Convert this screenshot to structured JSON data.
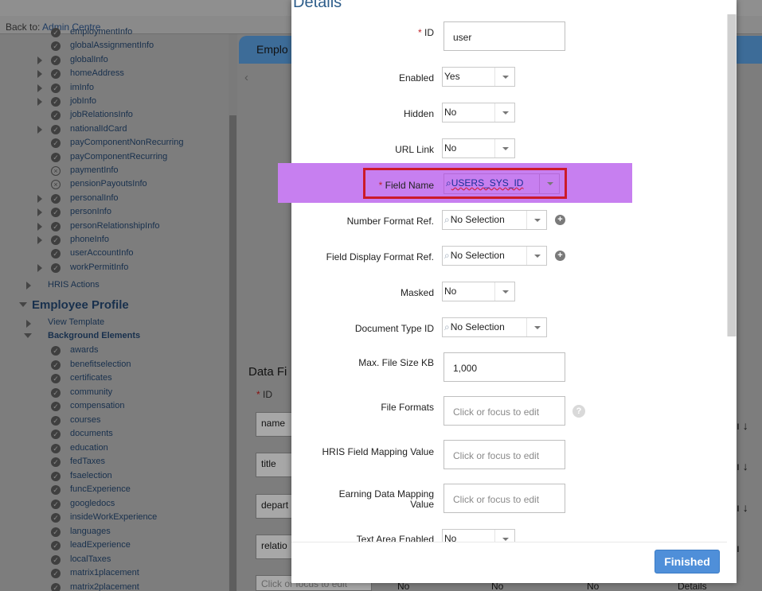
{
  "back": {
    "prefix": "Back to:",
    "link": "Admin Centre"
  },
  "tree": {
    "employment_items": [
      {
        "label": "employmentInfo",
        "icon": "check",
        "expander": false
      },
      {
        "label": "globalAssignmentInfo",
        "icon": "check",
        "expander": false
      },
      {
        "label": "globalInfo",
        "icon": "check",
        "expander": true
      },
      {
        "label": "homeAddress",
        "icon": "check",
        "expander": true
      },
      {
        "label": "imInfo",
        "icon": "check",
        "expander": true
      },
      {
        "label": "jobInfo",
        "icon": "check",
        "expander": true
      },
      {
        "label": "jobRelationsInfo",
        "icon": "check",
        "expander": false
      },
      {
        "label": "nationalIdCard",
        "icon": "check",
        "expander": true
      },
      {
        "label": "payComponentNonRecurring",
        "icon": "check",
        "expander": false
      },
      {
        "label": "payComponentRecurring",
        "icon": "check",
        "expander": false
      },
      {
        "label": "paymentInfo",
        "icon": "x",
        "expander": false
      },
      {
        "label": "pensionPayoutsInfo",
        "icon": "x",
        "expander": false
      },
      {
        "label": "personalInfo",
        "icon": "check",
        "expander": true
      },
      {
        "label": "personInfo",
        "icon": "check",
        "expander": true
      },
      {
        "label": "personRelationshipInfo",
        "icon": "check",
        "expander": true
      },
      {
        "label": "phoneInfo",
        "icon": "check",
        "expander": true
      },
      {
        "label": "userAccountInfo",
        "icon": "check",
        "expander": false
      },
      {
        "label": "workPermitInfo",
        "icon": "check",
        "expander": true
      }
    ],
    "hris_actions": "HRIS Actions",
    "employee_profile": "Employee Profile",
    "view_template": "View Template",
    "background_elements": "Background Elements",
    "bg_items": [
      "awards",
      "benefitselection",
      "certificates",
      "community",
      "compensation",
      "courses",
      "documents",
      "education",
      "fedTaxes",
      "fsaelection",
      "funcExperience",
      "googledocs",
      "insideWorkExperience",
      "languages",
      "leadExperience",
      "localTaxes",
      "matrix1placement",
      "matrix2placement"
    ]
  },
  "background": {
    "panel_title": "Emplo",
    "data_fields_title": "Data Fi",
    "id_label": "ID",
    "id_required": "*",
    "rows": [
      "name",
      "title",
      "depart",
      "relatio"
    ],
    "bottom_placeholder": "Click or focus to edit",
    "bottom_selects": [
      "No",
      "No",
      "No"
    ],
    "details_link": "Details"
  },
  "modal": {
    "title": "Details",
    "required_marker": "*",
    "fields": {
      "id": {
        "label": "ID",
        "value": "user"
      },
      "enabled": {
        "label": "Enabled",
        "value": "Yes"
      },
      "hidden": {
        "label": "Hidden",
        "value": "No"
      },
      "url_link": {
        "label": "URL Link",
        "value": "No"
      },
      "field_name": {
        "label": "Field Name",
        "value": "USERS_SYS_ID"
      },
      "number_format": {
        "label": "Number Format Ref.",
        "value": "No Selection"
      },
      "field_display_format": {
        "label": "Field Display Format Ref.",
        "value": "No Selection"
      },
      "masked": {
        "label": "Masked",
        "value": "No"
      },
      "document_type": {
        "label": "Document Type ID",
        "value": "No Selection"
      },
      "max_file_size": {
        "label": "Max. File Size KB",
        "value": "1,000"
      },
      "file_formats": {
        "label": "File Formats",
        "placeholder": "Click or focus to edit"
      },
      "hris_mapping": {
        "label": "HRIS Field Mapping Value",
        "placeholder": "Click or focus to edit"
      },
      "earning_mapping": {
        "label_line1": "Earning Data Mapping",
        "label_line2": "Value",
        "placeholder": "Click or focus to edit"
      },
      "text_area": {
        "label": "Text Area Enabled",
        "value": "No"
      }
    },
    "finished_label": "Finished"
  },
  "colors": {
    "highlight": "#c77ff0",
    "highlight_border": "#cc1a2a",
    "primary_button": "#4f8fd9",
    "title": "#2d5d8a"
  }
}
